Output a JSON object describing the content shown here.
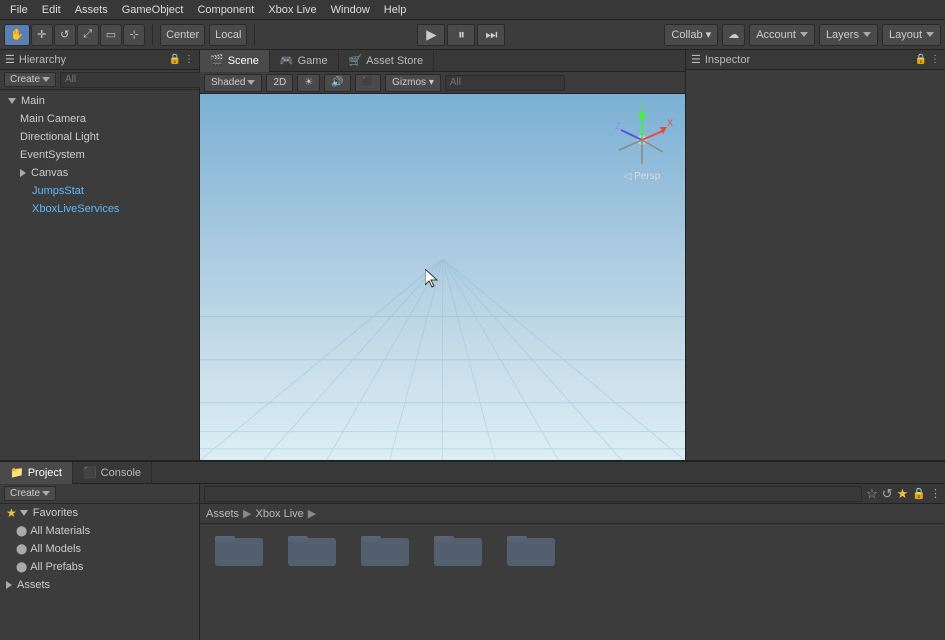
{
  "menubar": {
    "items": [
      "File",
      "Edit",
      "Assets",
      "GameObject",
      "Component",
      "Xbox Live",
      "Window",
      "Help"
    ]
  },
  "toolbar": {
    "tools": [
      "hand",
      "move",
      "rotate",
      "scale",
      "rect",
      "transform"
    ],
    "center_label": "Center",
    "local_label": "Local",
    "play_label": "▶",
    "pause_label": "⏸",
    "step_label": "⏭",
    "collab_label": "Collab ▾",
    "cloud_label": "☁",
    "account_label": "Account",
    "layers_label": "Layers",
    "layout_label": "Layout"
  },
  "hierarchy": {
    "title": "Hierarchy",
    "create_label": "Create",
    "search_placeholder": "All",
    "items": [
      {
        "label": "Main",
        "depth": 0,
        "expanded": true,
        "has_children": true
      },
      {
        "label": "Main Camera",
        "depth": 1,
        "expanded": false,
        "has_children": false
      },
      {
        "label": "Directional Light",
        "depth": 1,
        "expanded": false,
        "has_children": false
      },
      {
        "label": "EventSystem",
        "depth": 1,
        "expanded": false,
        "has_children": false
      },
      {
        "label": "Canvas",
        "depth": 1,
        "expanded": true,
        "has_children": true
      },
      {
        "label": "JumpsStat",
        "depth": 2,
        "expanded": false,
        "has_children": false,
        "blue": true
      },
      {
        "label": "XboxLiveServices",
        "depth": 2,
        "expanded": false,
        "has_children": false,
        "blue": true
      }
    ]
  },
  "scene": {
    "tabs": [
      {
        "label": "Scene",
        "icon": "🎬",
        "active": true
      },
      {
        "label": "Game",
        "icon": "🎮",
        "active": false
      },
      {
        "label": "Asset Store",
        "icon": "🛒",
        "active": false
      }
    ],
    "toolbar": {
      "shaded_label": "Shaded",
      "2d_label": "2D",
      "sun_label": "☀",
      "audio_label": "🔊",
      "fx_label": "⬛",
      "gizmos_label": "Gizmos ▾",
      "search_placeholder": "All"
    },
    "persp_label": "◁ Persp"
  },
  "inspector": {
    "title": "Inspector",
    "lock_icon": "🔒"
  },
  "project": {
    "tabs": [
      {
        "label": "Project",
        "icon": "📁",
        "active": true
      },
      {
        "label": "Console",
        "icon": "⬛",
        "active": false
      }
    ],
    "create_label": "Create",
    "search_placeholder": "",
    "tree": [
      {
        "label": "Favorites",
        "depth": 0,
        "star": true,
        "expanded": true
      },
      {
        "label": "All Materials",
        "depth": 1,
        "star": false
      },
      {
        "label": "All Models",
        "depth": 1,
        "star": false
      },
      {
        "label": "All Prefabs",
        "depth": 1,
        "star": false
      },
      {
        "label": "Assets",
        "depth": 0,
        "star": false,
        "expanded": false
      }
    ],
    "breadcrumb": [
      "Assets",
      "Xbox Live"
    ],
    "folders": [
      {
        "name": ""
      },
      {
        "name": ""
      },
      {
        "name": ""
      },
      {
        "name": ""
      },
      {
        "name": ""
      }
    ]
  }
}
